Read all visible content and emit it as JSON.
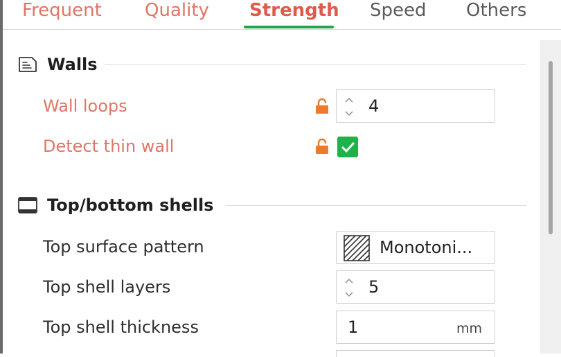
{
  "tabs": [
    {
      "label": "Frequent",
      "state": "modified"
    },
    {
      "label": "Quality",
      "state": "modified"
    },
    {
      "label": "Strength",
      "state": "active"
    },
    {
      "label": "Speed",
      "state": "normal"
    },
    {
      "label": "Others",
      "state": "normal"
    }
  ],
  "sections": {
    "walls": {
      "title": "Walls",
      "wall_loops": {
        "label": "Wall loops",
        "value": "4"
      },
      "detect_thin_wall": {
        "label": "Detect thin wall",
        "checked": true
      }
    },
    "shells": {
      "title": "Top/bottom shells",
      "top_surface_pattern": {
        "label": "Top surface pattern",
        "value": "Monotoni..."
      },
      "top_shell_layers": {
        "label": "Top shell layers",
        "value": "5"
      },
      "top_shell_thickness": {
        "label": "Top shell thickness",
        "value": "1",
        "unit": "mm"
      }
    }
  },
  "colors": {
    "accent_green": "#1ea64a",
    "modified_text": "#e07566",
    "active_tab": "#e05a4a",
    "lock_orange": "#ee7a2a"
  },
  "icons": {
    "walls_section": "wall-section-icon",
    "shells_section": "top-bottom-shells-icon",
    "unlocked": "unlocked-lock-icon",
    "spin": "spin-arrows-icon",
    "pattern": "monotonic-pattern-icon",
    "check": "checkmark-icon"
  }
}
